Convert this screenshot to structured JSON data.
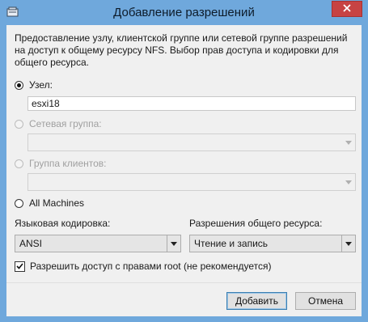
{
  "window": {
    "title": "Добавление разрешений",
    "close_icon": "close-x"
  },
  "description": "Предоставление узлу, клиентской группе или сетевой группе разрешений на доступ к общему ресурсу NFS. Выбор прав доступа и кодировки для общего ресурса.",
  "options": {
    "host": {
      "label": "Узел:",
      "value": "esxi18",
      "selected": true
    },
    "netgroup": {
      "label": "Сетевая группа:",
      "value": "",
      "enabled": false
    },
    "client_group": {
      "label": "Группа клиентов:",
      "value": "",
      "enabled": false
    },
    "all_machines": {
      "label": "All Machines",
      "selected": false
    }
  },
  "encoding": {
    "label": "Языковая кодировка:",
    "value": "ANSI"
  },
  "permissions": {
    "label": "Разрешения общего ресурса:",
    "value": "Чтение и запись"
  },
  "root_access": {
    "label": "Разрешить доступ с правами root (не рекомендуется)",
    "checked": true
  },
  "buttons": {
    "add": "Добавить",
    "cancel": "Отмена"
  }
}
